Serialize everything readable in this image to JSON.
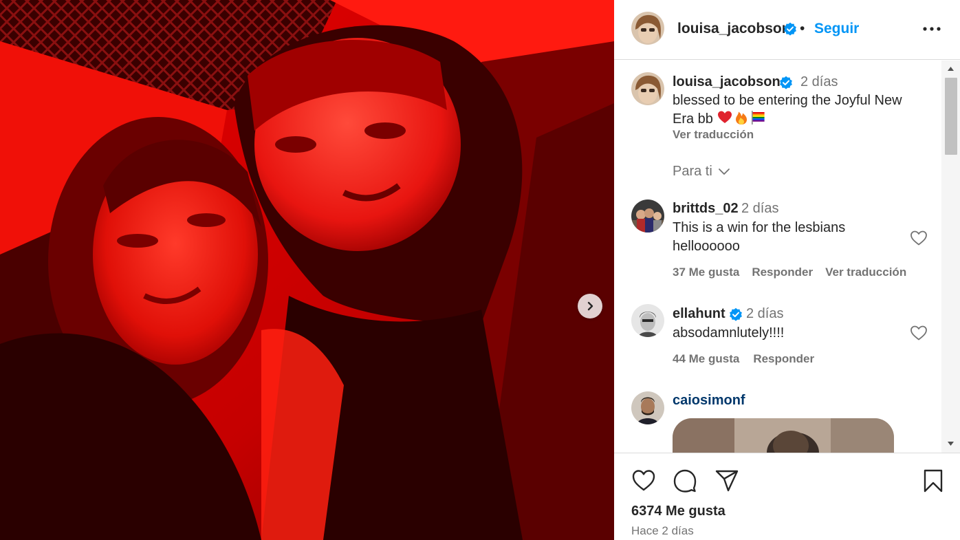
{
  "post": {
    "author": "louisa_jacobson",
    "follow_separator": "•",
    "follow_label": "Seguir",
    "likes_text": "6374 Me gusta",
    "posted_time": "Hace 2 días"
  },
  "caption": {
    "author": "louisa_jacobson",
    "time": "2 días",
    "text": "blessed to be entering the Joyful New Era bb",
    "emojis": [
      "red-heart",
      "fire",
      "rainbow-flag"
    ],
    "translate_label": "Ver traducción"
  },
  "filter": {
    "label": "Para ti"
  },
  "comments": [
    {
      "author": "brittds_02",
      "time": "2 días",
      "text": "This is a win for the lesbians helloooooo",
      "likes": "37 Me gusta",
      "reply_label": "Responder",
      "translate_label": "Ver traducción"
    },
    {
      "author": "ellahunt",
      "verified": true,
      "time": "2 días",
      "text": "absodamnlutely!!!!",
      "likes": "44 Me gusta",
      "reply_label": "Responder"
    },
    {
      "author": "caiosimonf"
    }
  ],
  "icons": {
    "next": "chevron-right-icon",
    "more": "more-horizontal-icon",
    "like": "heart-icon",
    "comment": "comment-icon",
    "share": "send-icon",
    "save": "bookmark-icon"
  },
  "colors": {
    "link_blue": "#0095f6",
    "verified_blue": "#0095f6",
    "muted": "#737373",
    "text": "#262626",
    "border": "#dbdbdb",
    "photo_red": "#d40000"
  }
}
